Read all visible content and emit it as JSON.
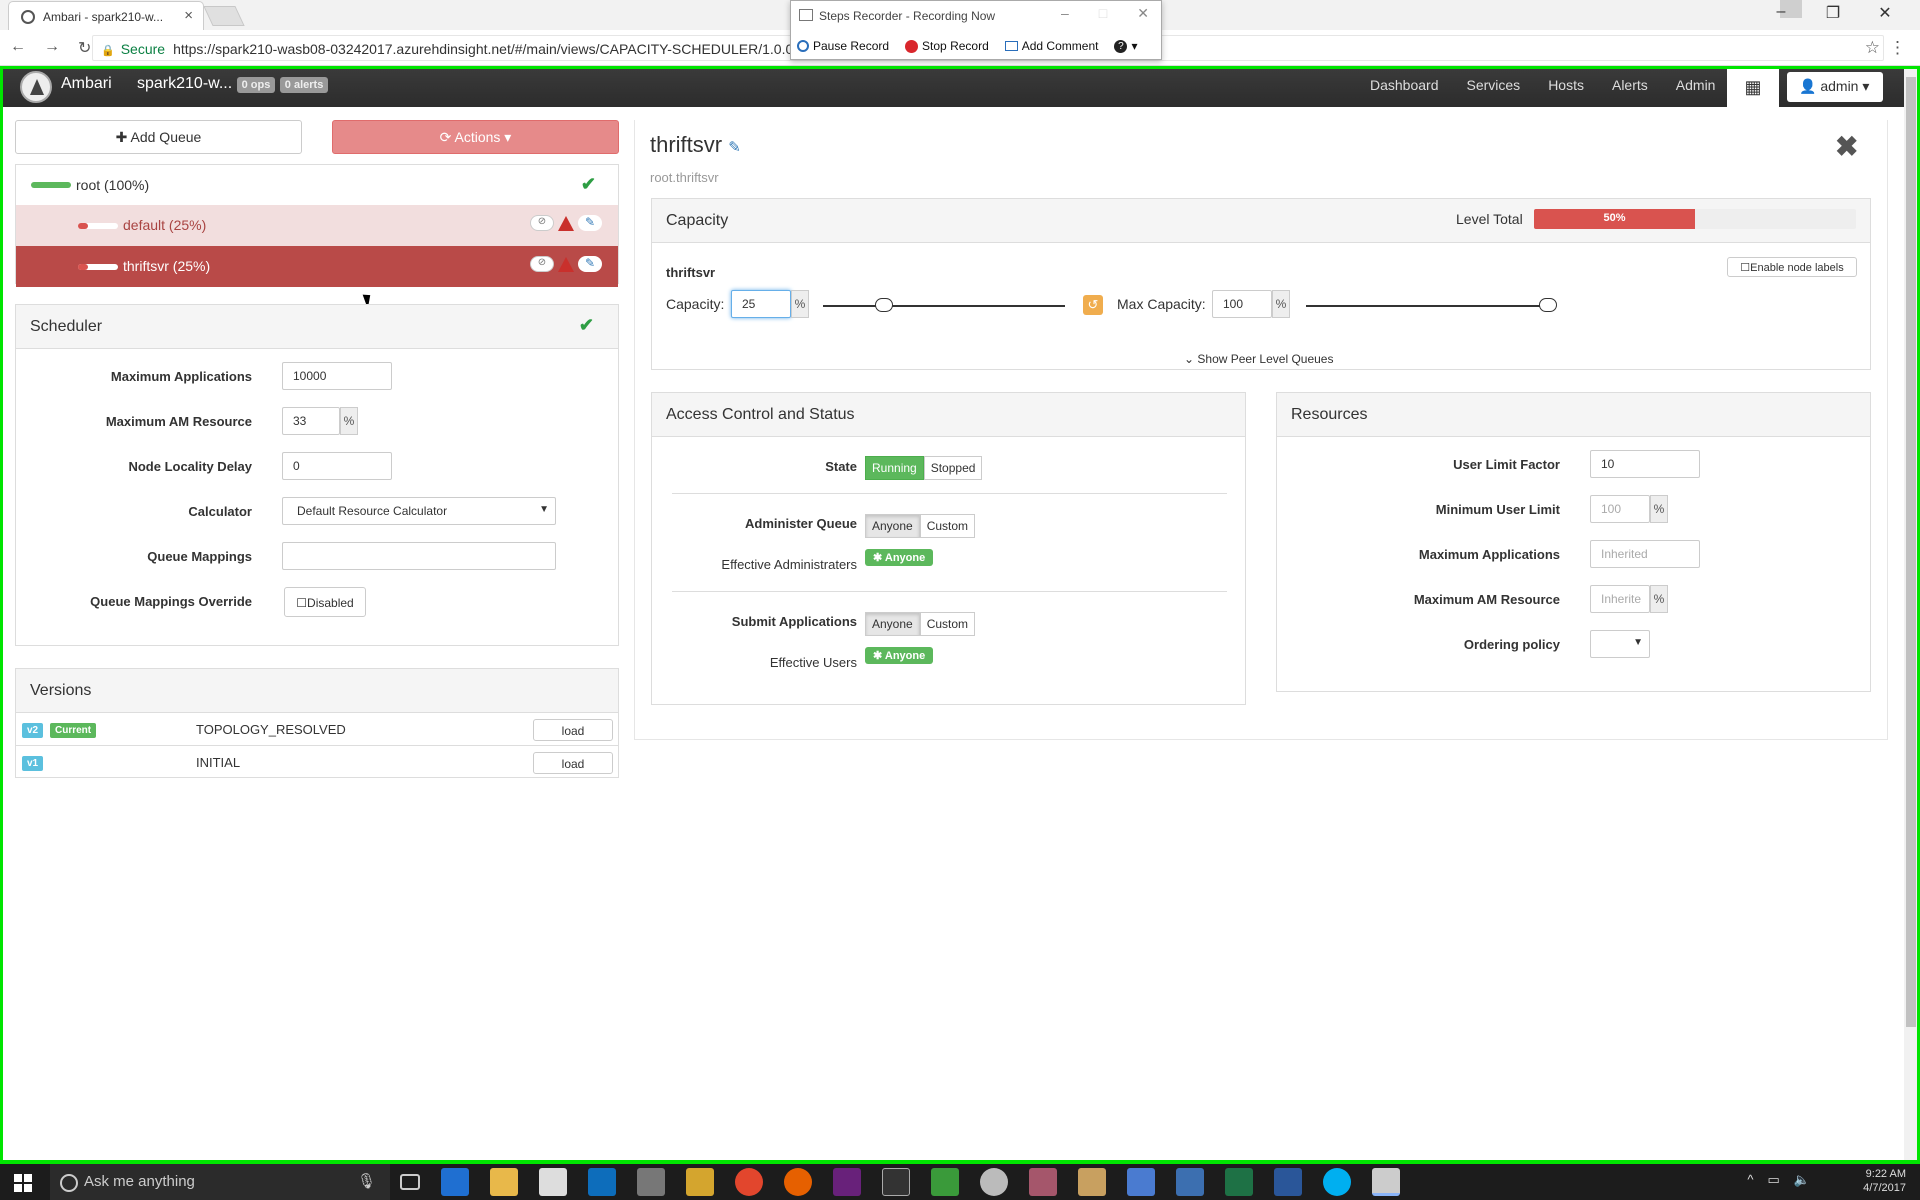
{
  "browser": {
    "tab_title": "Ambari - spark210-w...",
    "url_secure": "Secure",
    "url": "https://spark210-wasb08-03242017.azurehdinsight.net/#/main/views/CAPACITY-SCHEDULER/1.0.0/"
  },
  "steps_recorder": {
    "title": "Steps Recorder - Recording Now",
    "pause": "Pause Record",
    "stop": "Stop Record",
    "comment": "Add Comment"
  },
  "navbar": {
    "brand": "Ambari",
    "cluster": "spark210-w...",
    "ops_badge": "0 ops",
    "alerts_badge": "0 alerts",
    "links": [
      "Dashboard",
      "Services",
      "Hosts",
      "Alerts",
      "Admin"
    ],
    "user": "admin"
  },
  "left": {
    "add_queue": "Add Queue",
    "actions": "Actions",
    "queues": [
      {
        "label": "root (100%)",
        "fill": 1.0
      },
      {
        "label": "default (25%)",
        "fill": 0.25
      },
      {
        "label": "thriftsvr (25%)",
        "fill": 0.25
      }
    ],
    "scheduler": {
      "title": "Scheduler",
      "max_apps_label": "Maximum Applications",
      "max_apps": "10000",
      "max_am_label": "Maximum AM Resource",
      "max_am": "33",
      "pct": "%",
      "locality_label": "Node Locality Delay",
      "locality": "0",
      "calculator_label": "Calculator",
      "calculator": "Default Resource Calculator",
      "mappings_label": "Queue Mappings",
      "override_label": "Queue Mappings Override",
      "override": "Disabled"
    },
    "versions": {
      "title": "Versions",
      "rows": [
        {
          "tag": "v2",
          "current": "Current",
          "name": "TOPOLOGY_RESOLVED",
          "btn": "load"
        },
        {
          "tag": "v1",
          "current": "",
          "name": "INITIAL",
          "btn": "load"
        }
      ]
    }
  },
  "queue": {
    "name": "thriftsvr",
    "path": "root.thriftsvr",
    "capacity_title": "Capacity",
    "level_total_label": "Level Total",
    "level_total": "50%",
    "level_total_value": 0.5,
    "sub_name": "thriftsvr",
    "enable_labels": "Enable node labels",
    "capacity_label": "Capacity:",
    "capacity": "25",
    "capacity_value": 0.25,
    "max_capacity_label": "Max Capacity:",
    "max_capacity": "100",
    "max_capacity_value": 1.0,
    "peer_link": "Show Peer Level Queues",
    "access": {
      "title": "Access Control and Status",
      "state_label": "State",
      "running": "Running",
      "stopped": "Stopped",
      "admin_label": "Administer Queue",
      "anyone": "Anyone",
      "custom": "Custom",
      "eff_admin_label": "Effective Administraters",
      "eff_anyone": "Anyone",
      "submit_label": "Submit Applications",
      "eff_users_label": "Effective Users"
    },
    "resources": {
      "title": "Resources",
      "ulf_label": "User Limit Factor",
      "ulf": "10",
      "min_user_label": "Minimum User Limit",
      "min_user_ph": "100",
      "max_apps_label": "Maximum Applications",
      "max_apps_ph": "Inherited",
      "max_am_label": "Maximum AM Resource",
      "max_am_ph": "Inherite",
      "ordering_label": "Ordering policy"
    }
  },
  "taskbar": {
    "search": "Ask me anything",
    "time": "9:22 AM",
    "date": "4/7/2017"
  },
  "colors": {
    "navbar": "#2c2c2c",
    "danger": "#d9534f",
    "selected_queue": "#b94a48",
    "success": "#5cb85c",
    "info": "#5bc0de"
  }
}
